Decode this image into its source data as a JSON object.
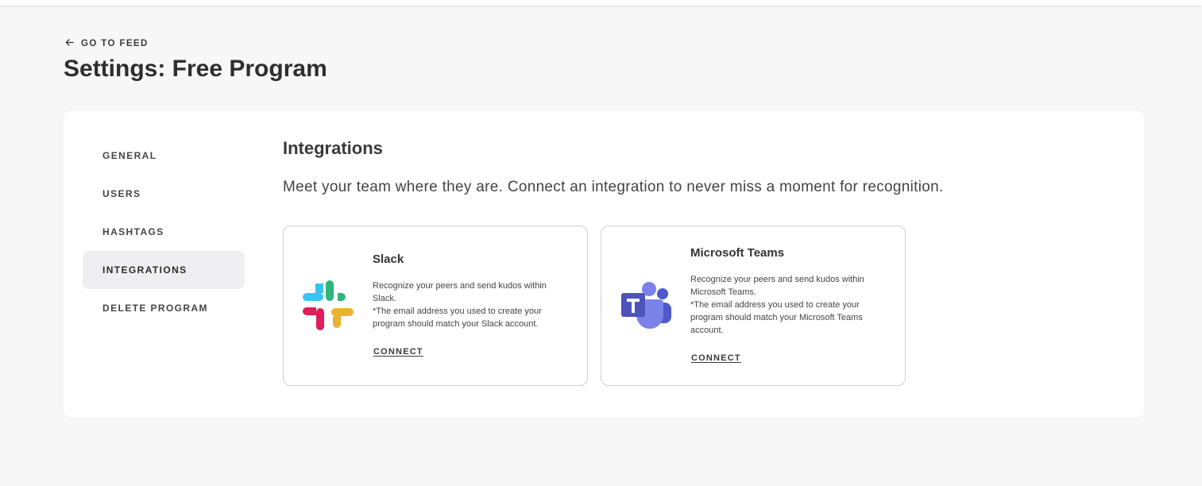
{
  "header": {
    "back_label": "GO TO FEED",
    "title": "Settings: Free Program"
  },
  "sidebar": {
    "items": [
      {
        "label": "GENERAL"
      },
      {
        "label": "USERS"
      },
      {
        "label": "HASHTAGS"
      },
      {
        "label": "INTEGRATIONS",
        "active": true
      },
      {
        "label": "DELETE PROGRAM"
      }
    ]
  },
  "main": {
    "title": "Integrations",
    "description": "Meet your team where they are. Connect an integration to never miss a moment for recognition.",
    "integrations": [
      {
        "name": "Slack",
        "icon": "slack-logo-icon",
        "desc1": "Recognize your peers and send kudos within Slack.",
        "desc2": "*The email address you used to create your program should match your Slack account.",
        "action": "CONNECT"
      },
      {
        "name": "Microsoft Teams",
        "icon": "microsoft-teams-logo-icon",
        "desc1": "Recognize your peers and send kudos within Microsoft Teams.",
        "desc2": "*The email address you used to create your program should match your Microsoft Teams account.",
        "action": "CONNECT"
      }
    ]
  },
  "colors": {
    "background": "#f7f7f7",
    "panel": "#ffffff",
    "active_nav": "#efeff1",
    "card_border": "#cfcfd4",
    "text": "#333333"
  }
}
